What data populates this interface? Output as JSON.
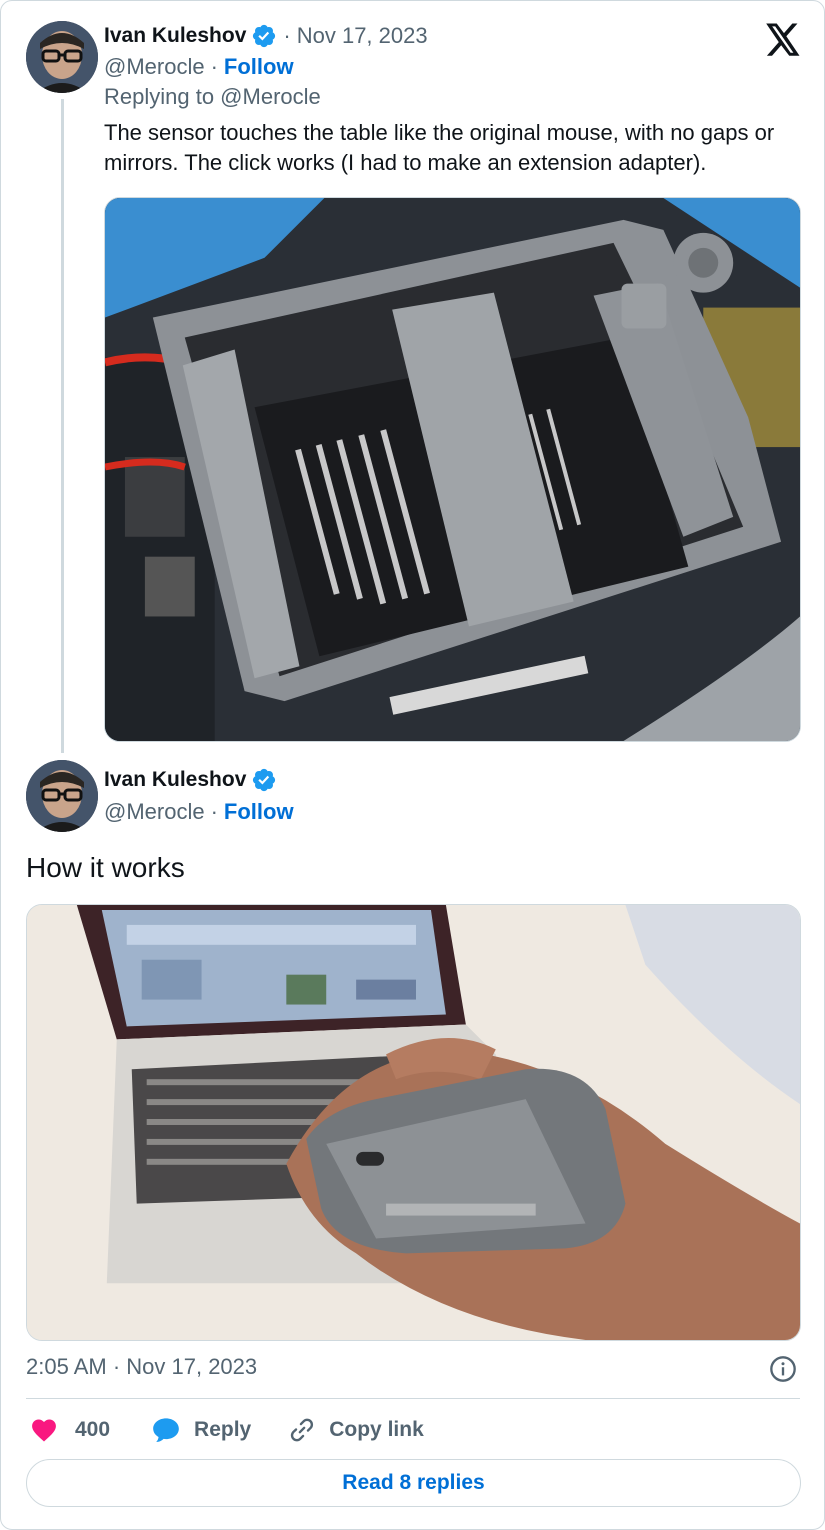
{
  "tweet1": {
    "author_name": "Ivan Kuleshov",
    "separator": "·",
    "date": "Nov 17, 2023",
    "handle": "@Merocle",
    "handle_sep": "·",
    "follow_label": "Follow",
    "replying_to": "Replying to @Merocle",
    "text_line1": "The sensor touches the table like the original mouse, with no gaps or",
    "text_line2": "mirrors. The click works (I had to make an extension adapter).",
    "media_type": "photo"
  },
  "tweet2": {
    "author_name": "Ivan Kuleshov",
    "handle": "@Merocle",
    "handle_sep": "·",
    "follow_label": "Follow",
    "text": "How it works",
    "media_type": "video-thumbnail"
  },
  "footer": {
    "timestamp": "2:05 AM · Nov 17, 2023",
    "like_count": "400",
    "reply_label": "Reply",
    "copy_link_label": "Copy link",
    "read_replies_label": "Read 8 replies"
  },
  "icons": {
    "brand": "x-logo-icon",
    "verified": "verified-badge-icon",
    "like": "heart-icon",
    "reply": "speech-bubble-icon",
    "copy": "link-icon",
    "info": "info-icon"
  },
  "colors": {
    "link_blue": "#006fd6",
    "verified_blue": "#1d9bf0",
    "heart_pink": "#f91880",
    "muted_text": "#536471",
    "border": "#cfd9de"
  }
}
